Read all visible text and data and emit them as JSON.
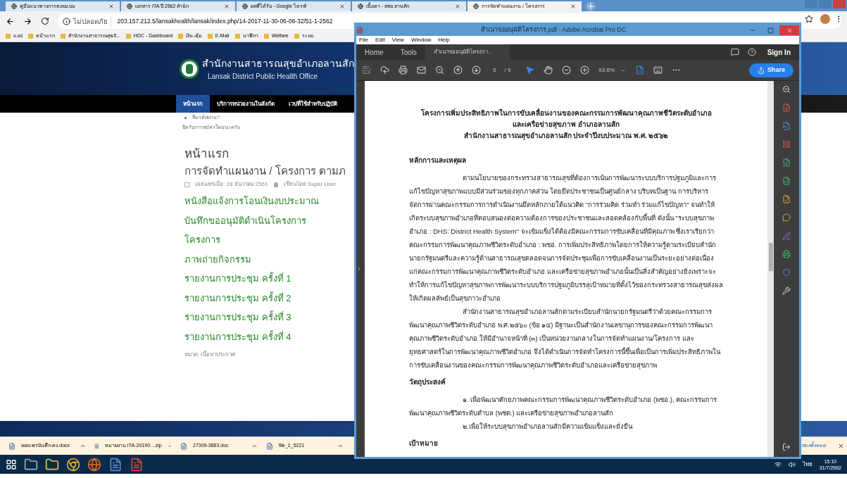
{
  "browser": {
    "tabs": [
      {
        "title": "คู่มือแนวทางการตอบแบบ",
        "selected": false
      },
      {
        "title": "เอกสาร ITA ปี 2562 สำนัก",
        "selected": false
      },
      {
        "title": "ผลที่ได้รับ - Google ไดรฟ์",
        "selected": false
      },
      {
        "title": "เนื้อหา - สสอ.ลานสัก",
        "selected": false
      },
      {
        "title": "การจัดทำแผนงาน / โครงการ",
        "selected": true
      }
    ],
    "security": "ไม่ปลอดภัย",
    "url": "203.157.212.5/lansakhealth/lansak/index.php/14-2017-11-30-06-08-32/51-1-2562",
    "bookmarks": [
      "แอป",
      "หน้าแรก",
      "สำนักงานสาธารณสุขจั...",
      "HDC - Dashboard",
      "เงิน-คุ้ม",
      "E-Mail",
      "นาฬิกา",
      "Welfare",
      "ระบบ"
    ]
  },
  "site": {
    "name": "สำนักงานสาธารณสุขอำเภอลานสัก",
    "subtitle": "Lansak District Public Health Office",
    "nav": [
      {
        "label": "หน้าแรก",
        "selected": true
      },
      {
        "label": "บริการหน่วยงานในสังกัด",
        "selected": false
      },
      {
        "label": "เวปที่ใช้สำหรับปฏิบัติ",
        "selected": false
      }
    ],
    "forgot": "ลืมรหัสผ่าน?",
    "notice": "ปิดรับการสมัครใหม่นะครับ",
    "breadcrumb": "หน้าแรก",
    "title": "การจัดทำแผนงาน / โครงการ ตามภ",
    "published": "เผยแพร่เมื่อ: 28 ธันวาคม 2561",
    "author": "เขียนโดย Super User",
    "links": [
      "หนังสือแจ้งการโอนเงินงบประมาณ",
      "บันทึกขออนุมัติดำเนินโครงการ",
      "โครงการ",
      "ภาพถ่ายกิจกรรม",
      "รายงานการประชุม ครั้งที่ 1",
      "รายงานการประชุม ครั้งที่ 2",
      "รายงานการประชุม ครั้งที่ 3",
      "รายงานการประชุม ครั้งที่ 4"
    ],
    "category": "หมวด: เนื้อหาประกาศ"
  },
  "downloads": {
    "items": [
      "เผยแพร่บันทึก-คง.docx",
      "หมายงาน ITA-20190....zip",
      "27309-3863.doc",
      "file_1_5221"
    ],
    "show_all": "สดงทั้งหมด"
  },
  "acrobat": {
    "title": "สำเนาขออนุมัติโครงการ.pdf - Adobe Acrobat Pro DC",
    "menu": [
      "File",
      "Edit",
      "View",
      "Window",
      "Help"
    ],
    "tabs": [
      {
        "label": "Home",
        "selected": false
      },
      {
        "label": "Tools",
        "selected": false
      },
      {
        "label": "สำเนาขออนุมัติโครงกา...",
        "selected": true
      }
    ],
    "sign_in": "Sign In",
    "page": "5",
    "pages": "/ 9",
    "zoom": "93.6%",
    "share": "Share",
    "document": [
      {
        "kind": "title",
        "lines": [
          "โครงการเพิ่มประสิทธิภาพในการขับเคลื่อนงานของคณะกรรมการพัฒนาคุณภาพชีวิตระดับอำเภอ",
          "และเครือข่ายสุขภาพ อำเภอลานสัก",
          "สำนักงานสาธารณสุขอำเภอลานสัก ประจำปีงบประมาณ พ.ศ. ๒๕๖๒"
        ]
      },
      {
        "kind": "heading",
        "lines": [
          "หลักการและเหตุผล"
        ]
      },
      {
        "kind": "paragraph",
        "lines": [
          "ตามนโยบายของกระทรวงสาธารณสุขที่ต้องการเน้นการพัฒนาระบบบริการปฐมภูมิและการ",
          "แก้ไขปัญหาสุขภาพแบบมีส่วนร่วมของทุกภาคส่วน โดยยึดประชาชนเป็นศูนย์กลาง บริบทเป็นฐาน การบริหาร",
          "จัดการผ่านคณะกรรมการการดำเนินงานยึดหลักภายใต้แนวคิด \"การร่วมคิด ร่วมทำ ร่วมแก้ไขปัญหา\" จนทำให้",
          "เกิดระบบสุขภาพอำเภอที่ตอบสนองต่อความต้องการของประชาชนและสอดคล้องกับพื้นที่ ดังนั้น \"ระบบสุขภาพ",
          "อำเภอ : DHS: District Health System\" จะเข้มแข็งได้ต้องมีคณะกรรมการขับเคลื่อนที่มีคุณภาพ ซึ่งเราเรียกว่า",
          "คณะกรรมการพัฒนาคุณภาพชีวิตระดับอำเภอ : พชอ. การเพิ่มประสิทธิภาพโดยการให้ความรู้ตามระเบียบสำนัก",
          "นายกรัฐมนตรีและความรู้ด้านสาธารณสุขตลอดจนการจัดประชุมเพื่อการขับเคลื่อนงานเป็นระยะอย่างต่อเนื่อง",
          "แก่คณะกรรมการพัฒนาคุณภาพชีวิตระดับอำเภอ และเครือข่ายสุขภาพอำเภอนั้นเป็นสิ่งสำคัญอย่างยิ่งเพราะจะ",
          "ทำให้การแก้ไขปัญหาสุขภาพการพัฒนาระบบบริการปฐมภูมิบรรลุเป้าหมายที่ตั้งไว้ของกระทรวงสาธารณสุขส่งผล",
          "ให้เกิดผลลัพธ์เป็นสุขภาวะอำเภอ"
        ]
      },
      {
        "kind": "paragraph",
        "lines": [
          "สำนักงานสาธารณสุขอำเภอลานสักตามระเบียบสำนักนายกรัฐมนตรีว่าด้วยคณะกรรมการ",
          "พัฒนาคุณภาพชีวิตระดับอำเภอ พ.ศ.๒๕๖๐ (ข้อ ๑๔) มีฐานะเป็นสำนักงานเลขานุการของคณะกรรมการพัฒนา",
          "คุณภาพชีวิตระดับอำเภอ ให้มีอำนาจหน้าที่ (๓) เป็นหน่วยงานกลางในการจัดทำแผนงาน/โครงการ และ",
          "ยุทธศาสตร์ในการพัฒนาคุณภาพชีวิตอำเภอ จึงได้ดำเนินการจัดทำโครงการนี้ขึ้นเพื่อเป็นการเพิ่มประสิทธิภาพใน",
          "การขับเคลื่อนงานของคณะกรรมการพัฒนาคุณภาพชีวิตระดับอำเภอและเครือข่ายสุขภาพ"
        ]
      },
      {
        "kind": "heading",
        "lines": [
          "วัตถุประสงค์"
        ]
      },
      {
        "kind": "paragraph",
        "lines": [
          "๑. เพื่อพัฒนาศักยภาพคณะกรรมการพัฒนาคุณภาพชีวิตระดับอำเภอ (พชอ.), คณะกรรมการ",
          "พัฒนาคุณภาพชีวิตระดับตำบล (พชต.) และเครือข่ายสุขภาพอำเภอลานสัก"
        ]
      },
      {
        "kind": "paragraph",
        "lines": [
          "๒.เพื่อให้ระบบสุขภาพอำเภอลานสักมีความเข้มแข็งและยั่งยืน"
        ]
      },
      {
        "kind": "heading",
        "lines": [
          "เป้าหมาย"
        ]
      }
    ]
  },
  "taskbar": {
    "language": "ไทย",
    "time": "15:10",
    "date": "31/7/2562"
  }
}
